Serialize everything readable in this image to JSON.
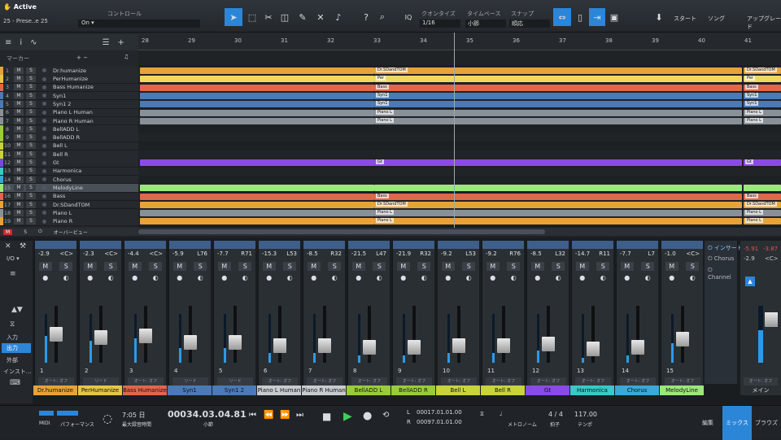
{
  "song": {
    "status": "Active",
    "name": "25 - Prese..e 25"
  },
  "toolbar": {
    "control_label": "コントロール",
    "on_label": "On",
    "iq": "IQ",
    "quantize_label": "クオンタイズ",
    "quantize_value": "1/16",
    "timebase_label": "タイムベース",
    "timebase_value": "小節",
    "snap_label": "スナップ",
    "snap_value": "順応",
    "start": "スタート",
    "song_btn": "ソング",
    "upgrade": "アップグレード",
    "help": "?"
  },
  "tracks_header": {
    "marker": "マーカー",
    "plusminus": "+ −"
  },
  "ruler": [
    "28",
    "29",
    "30",
    "31",
    "32",
    "33",
    "34",
    "35",
    "36",
    "37",
    "38",
    "39",
    "40",
    "41"
  ],
  "tracks": [
    {
      "n": "1",
      "name": "Dr.humanize",
      "color": "#e8a23a"
    },
    {
      "n": "2",
      "name": "PerHumanize",
      "color": "#e8c44a"
    },
    {
      "n": "3",
      "name": "Bass Humanize",
      "color": "#e0674a"
    },
    {
      "n": "4",
      "name": "Syn1",
      "color": "#4a7ab8"
    },
    {
      "n": "5",
      "name": "Syn1 2",
      "color": "#4a7ab8"
    },
    {
      "n": "6",
      "name": "Piano L Human",
      "color": "#8a9098"
    },
    {
      "n": "7",
      "name": "Piano R Human",
      "color": "#8a9098"
    },
    {
      "n": "8",
      "name": "BellADD  L",
      "color": "#9acc3a"
    },
    {
      "n": "9",
      "name": "BellADD  R",
      "color": "#9acc3a"
    },
    {
      "n": "10",
      "name": "Bell L",
      "color": "#c8d43a"
    },
    {
      "n": "11",
      "name": "Bell R",
      "color": "#c8d43a"
    },
    {
      "n": "12",
      "name": "Gt",
      "color": "#7a4ad8"
    },
    {
      "n": "13",
      "name": "Harmonica",
      "color": "#3ac8c8"
    },
    {
      "n": "14",
      "name": "Chorus",
      "color": "#3aa8d8"
    },
    {
      "n": "15",
      "name": "MelodyLine",
      "color": "#9ae87a"
    },
    {
      "n": "16",
      "name": "Bass",
      "color": "#e0674a"
    },
    {
      "n": "17",
      "name": "Dr.SDandTOM",
      "color": "#e8a23a"
    },
    {
      "n": "18",
      "name": "Piano L",
      "color": "#8a9098"
    },
    {
      "n": "19",
      "name": "Piano R",
      "color": "#e8a23a"
    }
  ],
  "clips": [
    {
      "lane": 0,
      "label": "Dr.SDandTOM",
      "color": "#e8a23a"
    },
    {
      "lane": 1,
      "label": "Per",
      "color": "#f0d860"
    },
    {
      "lane": 2,
      "label": "Bass",
      "color": "#e0674a"
    },
    {
      "lane": 3,
      "label": "Syn1",
      "color": "#4a7ab8"
    },
    {
      "lane": 4,
      "label": "Syn1",
      "color": "#4a7ab8"
    },
    {
      "lane": 5,
      "label": "Piano L",
      "color": "#8a9098"
    },
    {
      "lane": 6,
      "label": "Piano L",
      "color": "#8a9098"
    },
    {
      "lane": 11,
      "label": "Gt",
      "color": "#8a4ae8"
    },
    {
      "lane": 14,
      "label": "",
      "color": "#9ae87a"
    },
    {
      "lane": 15,
      "label": "Bass",
      "color": "#e0674a"
    },
    {
      "lane": 16,
      "label": "Dr.SDandTOM",
      "color": "#e8a23a"
    },
    {
      "lane": 17,
      "label": "Piano L",
      "color": "#8a9098"
    },
    {
      "lane": 18,
      "label": "Piano L",
      "color": "#e8a23a"
    }
  ],
  "overview": "オーバービュー",
  "mixer_side": {
    "io": "I/O",
    "input": "入力",
    "output": "出力",
    "external": "外部",
    "instrument": "インスト..."
  },
  "channels": [
    {
      "n": "1",
      "vol": "-2.9",
      "pan": "<C>",
      "name": "Dr.humanize",
      "color": "#e8a23a",
      "auto": "オート: オフ",
      "level": 0.55
    },
    {
      "n": "2",
      "vol": "-2.3",
      "pan": "<C>",
      "name": "PerHumanize",
      "color": "#e8c44a",
      "auto": "リード",
      "level": 0.45
    },
    {
      "n": "3",
      "vol": "-4.4",
      "pan": "<C>",
      "name": "Bass Humanize",
      "color": "#e0674a",
      "auto": "オート: オフ",
      "level": 0.5
    },
    {
      "n": "4",
      "vol": "-5.9",
      "pan": "L76",
      "name": "Syn1",
      "color": "#4a7ab8",
      "auto": "リード",
      "level": 0.3
    },
    {
      "n": "5",
      "vol": "-7.7",
      "pan": "R71",
      "name": "Syn1 2",
      "color": "#4a7ab8",
      "auto": "リード",
      "level": 0.3
    },
    {
      "n": "6",
      "vol": "-15.3",
      "pan": "L53",
      "name": "Piano L Human",
      "color": "#c8ccd0",
      "auto": "オート: オフ",
      "level": 0.2
    },
    {
      "n": "7",
      "vol": "-8.5",
      "pan": "R32",
      "name": "Piano R Human",
      "color": "#c8ccd0",
      "auto": "オート: オフ",
      "level": 0.2
    },
    {
      "n": "8",
      "vol": "-21.5",
      "pan": "L47",
      "name": "BellADD   L",
      "color": "#9acc3a",
      "auto": "オート: オフ",
      "level": 0.15
    },
    {
      "n": "9",
      "vol": "-21.9",
      "pan": "R32",
      "name": "BellADD   R",
      "color": "#9acc3a",
      "auto": "オート: オフ",
      "level": 0.15
    },
    {
      "n": "10",
      "vol": "-9.2",
      "pan": "L53",
      "name": "Bell L",
      "color": "#c8d43a",
      "auto": "オート: オフ",
      "level": 0.2
    },
    {
      "n": "11",
      "vol": "-9.2",
      "pan": "R76",
      "name": "Bell R",
      "color": "#c8d43a",
      "auto": "オート: オフ",
      "level": 0.2
    },
    {
      "n": "12",
      "vol": "-8.5",
      "pan": "L32",
      "name": "Gt",
      "color": "#8a4ae8",
      "auto": "オート: オフ",
      "level": 0.25
    },
    {
      "n": "13",
      "vol": "-14.7",
      "pan": "R11",
      "name": "Harmonica",
      "color": "#3ac8c8",
      "auto": "オート: オフ",
      "level": 0.1
    },
    {
      "n": "14",
      "vol": "-7.7",
      "pan": "L7",
      "name": "Chorus",
      "color": "#3aa8d8",
      "auto": "オート: オフ",
      "level": 0.15
    },
    {
      "n": "15",
      "vol": "-1.0",
      "pan": "<C>",
      "name": "MelodyLine",
      "color": "#9ae87a",
      "auto": "オート: オフ",
      "level": 0.4
    }
  ],
  "inserts": {
    "label": "インサート",
    "item1": "Chorus",
    "item2": "Channel"
  },
  "main": {
    "l": "-5.91",
    "r": "-3.87",
    "vol": "-2.9",
    "pan": "<C>",
    "name": "メイン",
    "auto": "オート: オフ"
  },
  "transport": {
    "midi": "MIDI",
    "perf": "パフォーマンス",
    "rec_time": "7:05 日",
    "rec_label": "最大録音時間",
    "position": "00034.03.04.81",
    "pos_label": "小節",
    "loop_l": "00017.01.01.00",
    "loop_r": "00097.01.01.00",
    "l": "L",
    "r": "R",
    "metronome": "メトロノーム",
    "sig": "4 / 4",
    "sig_label": "拍子",
    "tempo": "117.00",
    "tempo_label": "テンポ",
    "edit": "編集",
    "mix": "ミックス",
    "browse": "ブラウズ"
  }
}
